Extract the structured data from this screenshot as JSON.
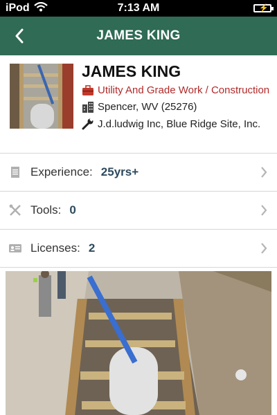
{
  "status_bar": {
    "carrier": "iPod",
    "time": "7:13 AM"
  },
  "nav": {
    "title": "JAMES KING"
  },
  "profile": {
    "name": "JAMES KING",
    "trade": "Utility And Grade Work / Construction",
    "location": "Spencer, WV (25276)",
    "employers": "J.d.ludwig Inc, Blue Ridge Site, Inc."
  },
  "rows": [
    {
      "label": "Experience:",
      "value": "25yrs+"
    },
    {
      "label": "Tools:",
      "value": "0"
    },
    {
      "label": "Licenses:",
      "value": "2"
    }
  ],
  "colors": {
    "nav_bg": "#2f6b55",
    "trade_text": "#b02a2a",
    "value_text": "#2e4a5e"
  }
}
